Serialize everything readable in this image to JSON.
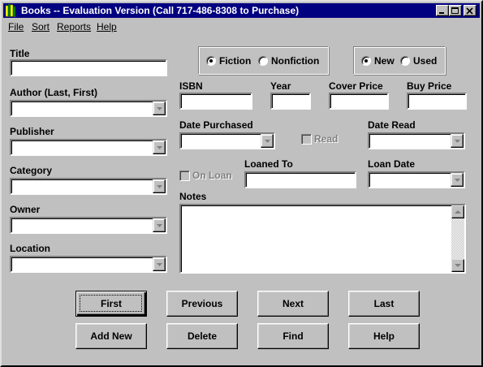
{
  "window": {
    "title": "Books -- Evaluation Version (Call 717-486-8308 to Purchase)"
  },
  "menu": [
    "File",
    "Sort",
    "Reports",
    "Help"
  ],
  "fields": {
    "title": {
      "label": "Title",
      "value": ""
    },
    "author": {
      "label": "Author (Last, First)",
      "value": ""
    },
    "publisher": {
      "label": "Publisher",
      "value": ""
    },
    "category": {
      "label": "Category",
      "value": ""
    },
    "owner": {
      "label": "Owner",
      "value": ""
    },
    "location": {
      "label": "Location",
      "value": ""
    },
    "isbn": {
      "label": "ISBN",
      "value": ""
    },
    "year": {
      "label": "Year",
      "value": ""
    },
    "cover_price": {
      "label": "Cover Price",
      "value": ""
    },
    "buy_price": {
      "label": "Buy Price",
      "value": ""
    },
    "date_purchased": {
      "label": "Date Purchased",
      "value": ""
    },
    "read": {
      "label": "Read",
      "checked": false,
      "enabled": false
    },
    "date_read": {
      "label": "Date Read",
      "value": ""
    },
    "on_loan": {
      "label": "On Loan",
      "checked": false,
      "enabled": false
    },
    "loaned_to": {
      "label": "Loaned To",
      "value": ""
    },
    "loan_date": {
      "label": "Loan Date",
      "value": ""
    },
    "notes": {
      "label": "Notes",
      "value": ""
    }
  },
  "genre": {
    "options": [
      "Fiction",
      "Nonfiction"
    ],
    "selected": "Fiction"
  },
  "condition": {
    "options": [
      "New",
      "Used"
    ],
    "selected": "New"
  },
  "buttons": {
    "first": "First",
    "previous": "Previous",
    "next": "Next",
    "last": "Last",
    "add_new": "Add New",
    "delete": "Delete",
    "find": "Find",
    "help": "Help"
  },
  "colors": {
    "titlebar": "#000080",
    "face": "#c0c0c0"
  }
}
